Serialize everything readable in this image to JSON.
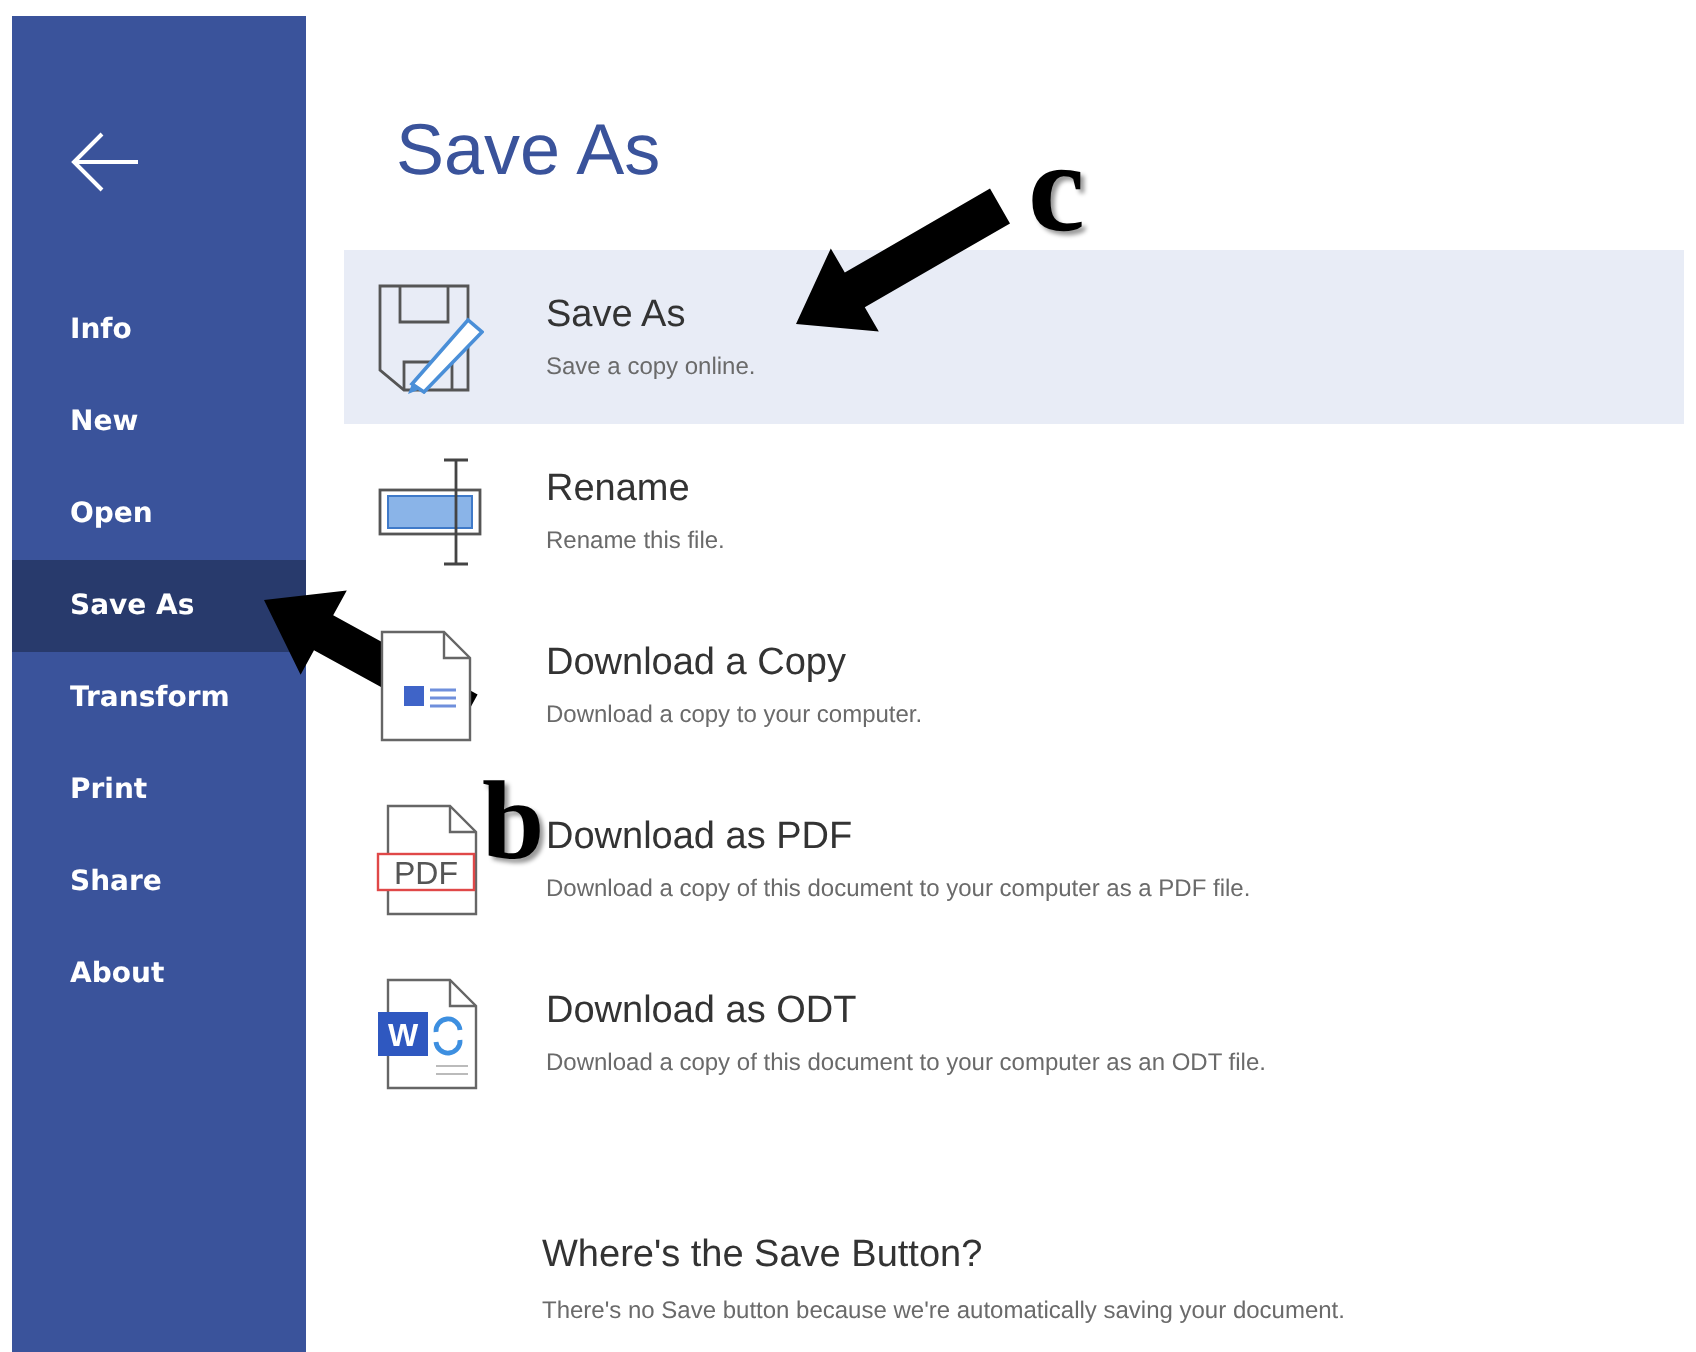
{
  "sidebar": {
    "items": [
      {
        "label": "Info",
        "selected": false
      },
      {
        "label": "New",
        "selected": false
      },
      {
        "label": "Open",
        "selected": false
      },
      {
        "label": "Save As",
        "selected": true
      },
      {
        "label": "Transform",
        "selected": false
      },
      {
        "label": "Print",
        "selected": false
      },
      {
        "label": "Share",
        "selected": false
      },
      {
        "label": "About",
        "selected": false
      }
    ]
  },
  "title": "Save As",
  "options": [
    {
      "kind": "save",
      "title": "Save As",
      "description": "Save a copy online.",
      "selected": true
    },
    {
      "kind": "rename",
      "title": "Rename",
      "description": "Rename this file.",
      "selected": false
    },
    {
      "kind": "download",
      "title": "Download a Copy",
      "description": "Download a copy to your computer.",
      "selected": false
    },
    {
      "kind": "pdf",
      "title": "Download as PDF",
      "description": "Download a copy of this document to your computer as a PDF file.",
      "selected": false,
      "icon_text": "PDF"
    },
    {
      "kind": "odt",
      "title": "Download as ODT",
      "description": "Download a copy of this document to your computer as an ODT file.",
      "selected": false,
      "icon_text": "W"
    }
  ],
  "info": {
    "title": "Where's the Save Button?",
    "description": "There's no Save button because we're automatically saving your document."
  },
  "annotations": [
    {
      "label": "b"
    },
    {
      "label": "c"
    }
  ]
}
